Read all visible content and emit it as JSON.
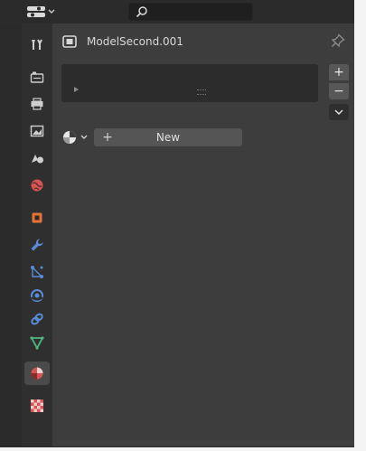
{
  "header": {
    "search": {
      "placeholder": ""
    }
  },
  "breadcrumb": {
    "object_name": "ModelSecond.001"
  },
  "material_slots": {
    "items": [],
    "buttons": {
      "add": "+",
      "remove": "−",
      "specials": "⌄"
    }
  },
  "material": {
    "new_plus": "+",
    "new_label": "New"
  },
  "tabs": [
    {
      "name": "tool",
      "active": false
    },
    {
      "name": "render",
      "active": false
    },
    {
      "name": "output",
      "active": false
    },
    {
      "name": "view-layer",
      "active": false
    },
    {
      "name": "scene",
      "active": false
    },
    {
      "name": "world",
      "active": false
    },
    {
      "name": "object",
      "active": false
    },
    {
      "name": "modifiers",
      "active": false
    },
    {
      "name": "particles",
      "active": false
    },
    {
      "name": "physics",
      "active": false
    },
    {
      "name": "constraints",
      "active": false
    },
    {
      "name": "data",
      "active": false
    },
    {
      "name": "material",
      "active": true
    },
    {
      "name": "texture",
      "active": false
    }
  ],
  "colors": {
    "accent_orange": "#e0743a",
    "accent_blue": "#5a8bd6",
    "accent_green": "#4fb77d",
    "accent_red": "#d65454"
  }
}
